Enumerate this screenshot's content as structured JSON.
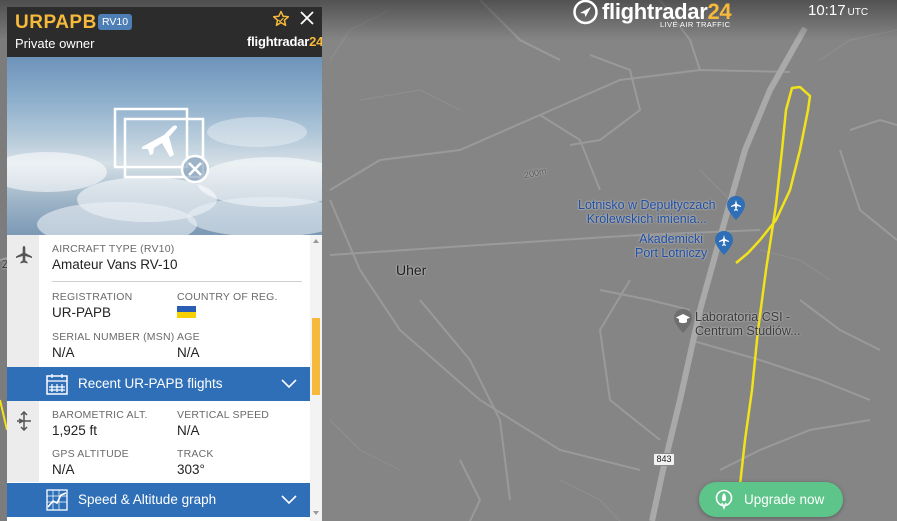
{
  "header": {
    "brand_name": "flightradar",
    "brand_accent": "24",
    "brand_tagline": "LIVE AIR TRAFFIC",
    "time": "10:17",
    "timezone": "UTC"
  },
  "panel": {
    "callsign": "URPAPB",
    "type_badge": "RV10",
    "owner": "Private owner",
    "brand_name": "flightradar",
    "brand_accent": "24",
    "aircraft": {
      "type_label": "AIRCRAFT TYPE (RV10)",
      "type_value": "Amateur Vans RV-10",
      "registration_label": "REGISTRATION",
      "registration_value": "UR-PAPB",
      "country_label": "COUNTRY OF REG.",
      "serial_label": "SERIAL NUMBER (MSN)",
      "serial_value": "N/A",
      "age_label": "AGE",
      "age_value": "N/A"
    },
    "recent_flights_label": "Recent UR-PAPB flights",
    "flight": {
      "baro_label": "BAROMETRIC ALT.",
      "baro_value": "1,925 ft",
      "vspeed_label": "VERTICAL SPEED",
      "vspeed_value": "N/A",
      "gps_label": "GPS ALTITUDE",
      "gps_value": "N/A",
      "track_label": "TRACK",
      "track_value": "303°"
    },
    "graph_label": "Speed & Altitude graph",
    "scroll_fraction": 0.39
  },
  "map": {
    "town_label": "Uher",
    "poi_airport_1": "Lotnisko w Depułtyczach",
    "poi_airport_2": "Królewskich imienia...",
    "poi_port_1": "Akademicki",
    "poi_port_2": "Port Lotniczy",
    "poi_lab_1": "Laboratoria CSI -",
    "poi_lab_2": "Centrum Studiów...",
    "elevation_label": "200m",
    "road_number": "843",
    "edge_label": "Z"
  },
  "upgrade_label": "Upgrade now",
  "colors": {
    "accent": "#f6b93b",
    "blue_bar": "#2f6fb7",
    "track_line": "#f2e21a",
    "upgrade": "#5dc48a"
  },
  "icons": [
    "star-icon",
    "close-icon",
    "plane-icon",
    "calendar-icon",
    "chevron-down-icon",
    "altitude-icon",
    "graph-icon",
    "airport-pin-icon",
    "education-pin-icon",
    "rocket-icon",
    "logo-icon"
  ]
}
